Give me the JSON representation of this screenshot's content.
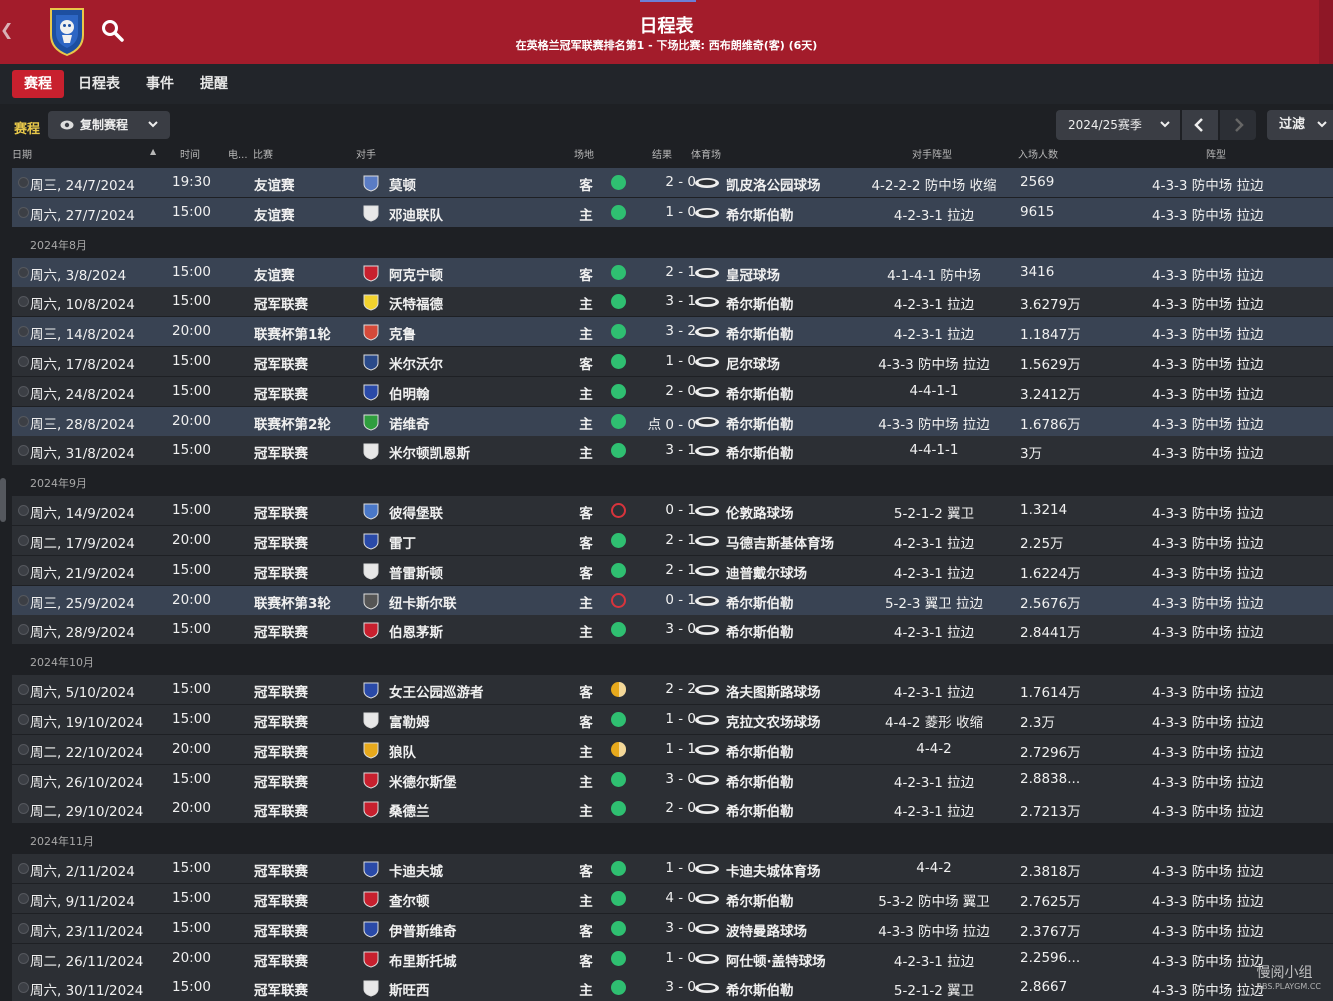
{
  "header": {
    "title": "日程表",
    "subtitle": "在英格兰冠军联赛排名第1 - 下场比赛: 西布朗维奇(客) (6天)"
  },
  "tabs": [
    {
      "label": "赛程",
      "active": true
    },
    {
      "label": "日程表",
      "active": false
    },
    {
      "label": "事件",
      "active": false
    },
    {
      "label": "提醒",
      "active": false
    }
  ],
  "toolbar": {
    "section_label": "赛程",
    "copy_button": "复制赛程",
    "season": "2024/25赛季",
    "filter": "过滤"
  },
  "columns": {
    "date": "日期",
    "time": "时间",
    "tv": "电...",
    "competition": "比赛",
    "opponent": "对手",
    "venue": "场地",
    "result": "结果",
    "stadium": "体育场",
    "opp_formation": "对手阵型",
    "attendance": "入场人数",
    "formation": "阵型"
  },
  "colors": {
    "header_red": "#a31c2b",
    "win": "#2fbf71",
    "loss": "#d8343c",
    "draw": "#e7a91c",
    "cup_row": "#394353"
  },
  "groups": [
    {
      "month": "",
      "matches": [
        {
          "date": "周三, 24/7/2024",
          "time": "19:30",
          "comp": "友谊赛",
          "opp": "莫顿",
          "venue": "客",
          "result": "W",
          "score": "2 - 0",
          "stadium": "凯皮洛公园球场",
          "opp_form": "4-2-2-2 防中场 收缩",
          "att": "2569",
          "form": "4-3-3 防中场 拉边",
          "cup": true,
          "badge": "#5a7cc4"
        },
        {
          "date": "周六, 27/7/2024",
          "time": "15:00",
          "comp": "友谊赛",
          "opp": "邓迪联队",
          "venue": "主",
          "result": "W",
          "score": "1 - 0",
          "stadium": "希尔斯伯勒",
          "opp_form": "4-2-3-1 拉边",
          "att": "9615",
          "form": "4-3-3 防中场 拉边",
          "cup": true,
          "badge": "#e8e8e8"
        }
      ]
    },
    {
      "month": "2024年8月",
      "matches": [
        {
          "date": "周六, 3/8/2024",
          "time": "15:00",
          "comp": "友谊赛",
          "opp": "阿克宁顿",
          "venue": "客",
          "result": "W",
          "score": "2 - 1",
          "stadium": "皇冠球场",
          "opp_form": "4-1-4-1 防中场",
          "att": "3416",
          "form": "4-3-3 防中场 拉边",
          "cup": true,
          "badge": "#c8202e"
        },
        {
          "date": "周六, 10/8/2024",
          "time": "15:00",
          "comp": "冠军联赛",
          "opp": "沃特福德",
          "venue": "主",
          "result": "W",
          "score": "3 - 1",
          "stadium": "希尔斯伯勒",
          "opp_form": "4-2-3-1 拉边",
          "att": "3.6279万",
          "form": "4-3-3 防中场 拉边",
          "cup": false,
          "badge": "#f2d22e"
        },
        {
          "date": "周三, 14/8/2024",
          "time": "20:00",
          "comp": "联赛杯第1轮",
          "opp": "克鲁",
          "venue": "主",
          "result": "W",
          "score": "3 - 2",
          "stadium": "希尔斯伯勒",
          "opp_form": "4-2-3-1 拉边",
          "att": "1.1847万",
          "form": "4-3-3 防中场 拉边",
          "cup": true,
          "badge": "#d44a3a"
        },
        {
          "date": "周六, 17/8/2024",
          "time": "15:00",
          "comp": "冠军联赛",
          "opp": "米尔沃尔",
          "venue": "客",
          "result": "W",
          "score": "1 - 0",
          "stadium": "尼尔球场",
          "opp_form": "4-3-3 防中场 拉边",
          "att": "1.5629万",
          "form": "4-3-3 防中场 拉边",
          "cup": false,
          "badge": "#2a4a8a"
        },
        {
          "date": "周六, 24/8/2024",
          "time": "15:00",
          "comp": "冠军联赛",
          "opp": "伯明翰",
          "venue": "主",
          "result": "W",
          "score": "2 - 0",
          "stadium": "希尔斯伯勒",
          "opp_form": "4-4-1-1",
          "att": "3.2412万",
          "form": "4-3-3 防中场 拉边",
          "cup": false,
          "badge": "#2a4aa8"
        },
        {
          "date": "周三, 28/8/2024",
          "time": "20:00",
          "comp": "联赛杯第2轮",
          "opp": "诺维奇",
          "venue": "主",
          "result": "W",
          "score": "点 0 - 0",
          "stadium": "希尔斯伯勒",
          "opp_form": "4-3-3 防中场 拉边",
          "att": "1.6786万",
          "form": "4-3-3 防中场 拉边",
          "cup": true,
          "badge": "#2f9e3e"
        },
        {
          "date": "周六, 31/8/2024",
          "time": "15:00",
          "comp": "冠军联赛",
          "opp": "米尔顿凯恩斯",
          "venue": "主",
          "result": "W",
          "score": "3 - 1",
          "stadium": "希尔斯伯勒",
          "opp_form": "4-4-1-1",
          "att": "3万",
          "form": "4-3-3 防中场 拉边",
          "cup": false,
          "badge": "#e8e8e8"
        }
      ]
    },
    {
      "month": "2024年9月",
      "matches": [
        {
          "date": "周六, 14/9/2024",
          "time": "15:00",
          "comp": "冠军联赛",
          "opp": "彼得堡联",
          "venue": "客",
          "result": "L",
          "score": "0 - 1",
          "stadium": "伦敦路球场",
          "opp_form": "5-2-1-2 翼卫",
          "att": "1.3214",
          "form": "4-3-3 防中场 拉边",
          "cup": false,
          "badge": "#4a78c8"
        },
        {
          "date": "周二, 17/9/2024",
          "time": "20:00",
          "comp": "冠军联赛",
          "opp": "雷丁",
          "venue": "客",
          "result": "W",
          "score": "2 - 1",
          "stadium": "马德吉斯基体育场",
          "opp_form": "4-2-3-1 拉边",
          "att": "2.25万",
          "form": "4-3-3 防中场 拉边",
          "cup": false,
          "badge": "#2a4aa8"
        },
        {
          "date": "周六, 21/9/2024",
          "time": "15:00",
          "comp": "冠军联赛",
          "opp": "普雷斯顿",
          "venue": "客",
          "result": "W",
          "score": "2 - 1",
          "stadium": "迪普戴尔球场",
          "opp_form": "4-2-3-1 拉边",
          "att": "1.6224万",
          "form": "4-3-3 防中场 拉边",
          "cup": false,
          "badge": "#e8e8e8"
        },
        {
          "date": "周三, 25/9/2024",
          "time": "20:00",
          "comp": "联赛杯第3轮",
          "opp": "纽卡斯尔联",
          "venue": "主",
          "result": "L",
          "score": "0 - 1",
          "stadium": "希尔斯伯勒",
          "opp_form": "5-2-3 翼卫 拉边",
          "att": "2.5676万",
          "form": "4-3-3 防中场 拉边",
          "cup": true,
          "badge": "#555555"
        },
        {
          "date": "周六, 28/9/2024",
          "time": "15:00",
          "comp": "冠军联赛",
          "opp": "伯恩茅斯",
          "venue": "主",
          "result": "W",
          "score": "3 - 0",
          "stadium": "希尔斯伯勒",
          "opp_form": "4-2-3-1 拉边",
          "att": "2.8441万",
          "form": "4-3-3 防中场 拉边",
          "cup": false,
          "badge": "#c8202e"
        }
      ]
    },
    {
      "month": "2024年10月",
      "matches": [
        {
          "date": "周六, 5/10/2024",
          "time": "15:00",
          "comp": "冠军联赛",
          "opp": "女王公园巡游者",
          "venue": "客",
          "result": "D",
          "score": "2 - 2",
          "stadium": "洛夫图斯路球场",
          "opp_form": "4-2-3-1 拉边",
          "att": "1.7614万",
          "form": "4-3-3 防中场 拉边",
          "cup": false,
          "badge": "#2a4aa8"
        },
        {
          "date": "周六, 19/10/2024",
          "time": "15:00",
          "comp": "冠军联赛",
          "opp": "富勒姆",
          "venue": "客",
          "result": "W",
          "score": "1 - 0",
          "stadium": "克拉文农场球场",
          "opp_form": "4-4-2 菱形 收缩",
          "att": "2.3万",
          "form": "4-3-3 防中场 拉边",
          "cup": false,
          "badge": "#e8e8e8"
        },
        {
          "date": "周二, 22/10/2024",
          "time": "20:00",
          "comp": "冠军联赛",
          "opp": "狼队",
          "venue": "主",
          "result": "D",
          "score": "1 - 1",
          "stadium": "希尔斯伯勒",
          "opp_form": "4-4-2",
          "att": "2.7296万",
          "form": "4-3-3 防中场 拉边",
          "cup": false,
          "badge": "#e7a91c"
        },
        {
          "date": "周六, 26/10/2024",
          "time": "15:00",
          "comp": "冠军联赛",
          "opp": "米德尔斯堡",
          "venue": "主",
          "result": "W",
          "score": "3 - 0",
          "stadium": "希尔斯伯勒",
          "opp_form": "4-2-3-1 拉边",
          "att": "2.8838...",
          "form": "4-3-3 防中场 拉边",
          "cup": false,
          "badge": "#c8202e"
        },
        {
          "date": "周二, 29/10/2024",
          "time": "20:00",
          "comp": "冠军联赛",
          "opp": "桑德兰",
          "venue": "主",
          "result": "W",
          "score": "2 - 0",
          "stadium": "希尔斯伯勒",
          "opp_form": "4-2-3-1 拉边",
          "att": "2.7213万",
          "form": "4-3-3 防中场 拉边",
          "cup": false,
          "badge": "#c8202e"
        }
      ]
    },
    {
      "month": "2024年11月",
      "matches": [
        {
          "date": "周六, 2/11/2024",
          "time": "15:00",
          "comp": "冠军联赛",
          "opp": "卡迪夫城",
          "venue": "客",
          "result": "W",
          "score": "1 - 0",
          "stadium": "卡迪夫城体育场",
          "opp_form": "4-4-2",
          "att": "2.3818万",
          "form": "4-3-3 防中场 拉边",
          "cup": false,
          "badge": "#2a4aa8"
        },
        {
          "date": "周六, 9/11/2024",
          "time": "15:00",
          "comp": "冠军联赛",
          "opp": "查尔顿",
          "venue": "主",
          "result": "W",
          "score": "4 - 0",
          "stadium": "希尔斯伯勒",
          "opp_form": "5-3-2 防中场 翼卫",
          "att": "2.7625万",
          "form": "4-3-3 防中场 拉边",
          "cup": false,
          "badge": "#c8202e"
        },
        {
          "date": "周六, 23/11/2024",
          "time": "15:00",
          "comp": "冠军联赛",
          "opp": "伊普斯维奇",
          "venue": "客",
          "result": "W",
          "score": "3 - 0",
          "stadium": "波特曼路球场",
          "opp_form": "4-3-3 防中场 拉边",
          "att": "2.3767万",
          "form": "4-3-3 防中场 拉边",
          "cup": false,
          "badge": "#2a4aa8"
        },
        {
          "date": "周二, 26/11/2024",
          "time": "20:00",
          "comp": "冠军联赛",
          "opp": "布里斯托城",
          "venue": "客",
          "result": "W",
          "score": "1 - 0",
          "stadium": "阿仕顿·盖特球场",
          "opp_form": "4-2-3-1 拉边",
          "att": "2.2596...",
          "form": "4-3-3 防中场 拉边",
          "cup": false,
          "badge": "#c8202e"
        },
        {
          "date": "周六, 30/11/2024",
          "time": "15:00",
          "comp": "冠军联赛",
          "opp": "斯旺西",
          "venue": "主",
          "result": "W",
          "score": "3 - 0",
          "stadium": "希尔斯伯勒",
          "opp_form": "5-2-1-2 翼卫",
          "att": "2.8667",
          "form": "4-3-3 防中场 拉边",
          "cup": false,
          "badge": "#e8e8e8"
        }
      ]
    }
  ],
  "watermark": {
    "text": "慢阅小组",
    "sub": "BBS.PLAYGM.CC"
  }
}
